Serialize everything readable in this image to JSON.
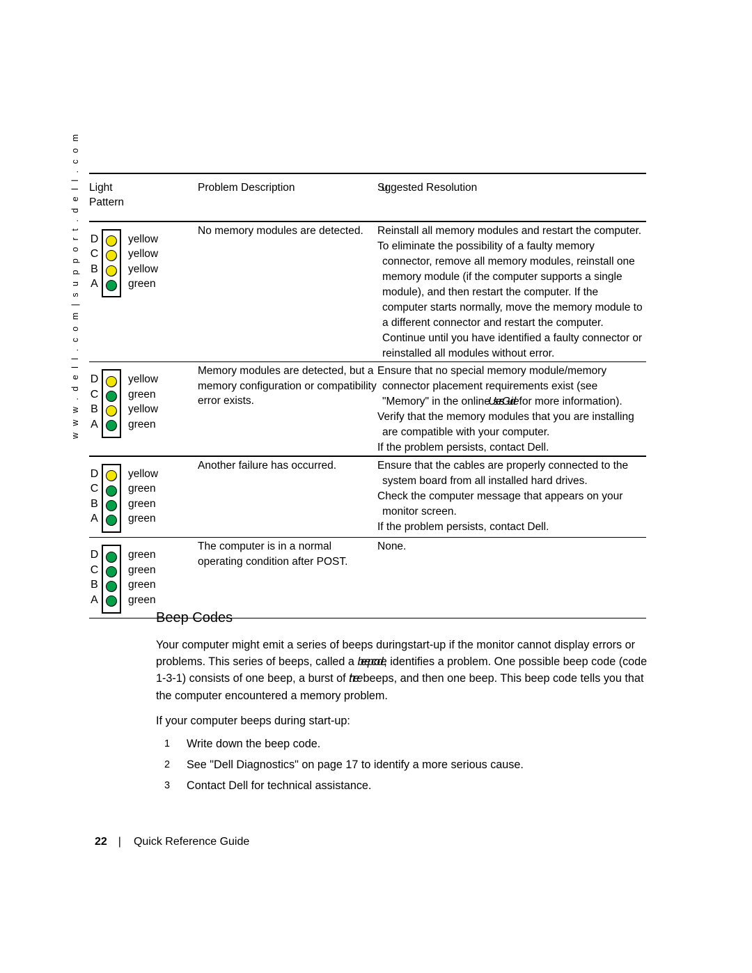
{
  "sidebar": {
    "running_head": "w w w . d e l l . c o m  |  s u p p o r t . d e l l . c o m"
  },
  "table": {
    "headers": {
      "pattern_line1": "Light",
      "pattern_line2": "Pattern",
      "problem": "Problem Description",
      "resolution_squeeze": "Su",
      "resolution_rest": "ggested Resolution"
    },
    "rows": [
      {
        "leds": [
          {
            "letter": "D",
            "color_name": "yellow",
            "color": "#F2E600"
          },
          {
            "letter": "C",
            "color_name": "yellow",
            "color": "#F2E600"
          },
          {
            "letter": "B",
            "color_name": "yellow",
            "color": "#F2E600"
          },
          {
            "letter": "A",
            "color_name": "green",
            "color": "#00A04A"
          }
        ],
        "problem": "No memory modules are detected.",
        "resolutions": [
          "Reinstall all memory modules and restart the computer.",
          "To eliminate the possibility of a faulty memory connector, remove all memory modules, reinstall one memory module (if the computer supports a single module), and then restart the computer. If the computer starts normally, move the memory module to a different connector and restart the computer. Continue until you have identified a faulty connector or reinstalled all modules without error."
        ]
      },
      {
        "leds": [
          {
            "letter": "D",
            "color_name": "yellow",
            "color": "#F2E600"
          },
          {
            "letter": "C",
            "color_name": "green",
            "color": "#00A04A"
          },
          {
            "letter": "B",
            "color_name": "yellow",
            "color": "#F2E600"
          },
          {
            "letter": "A",
            "color_name": "green",
            "color": "#00A04A"
          }
        ],
        "problem": "Memory modules are detected, but a memory configuration or compatibility error exists.",
        "resolutions": [
          "Ensure that no special memory module/memory connector placement requirements exist (see \"Memory\" in the online User s Guide for more information).",
          "Verify that the memory modules that you are installing are compatible with your computer.",
          "If the problem persists, contact Dell."
        ],
        "italic_phrase": "User s Guide"
      },
      {
        "leds": [
          {
            "letter": "D",
            "color_name": "yellow",
            "color": "#F2E600"
          },
          {
            "letter": "C",
            "color_name": "green",
            "color": "#00A04A"
          },
          {
            "letter": "B",
            "color_name": "green",
            "color": "#00A04A"
          },
          {
            "letter": "A",
            "color_name": "green",
            "color": "#00A04A"
          }
        ],
        "problem": "Another failure has occurred.",
        "resolutions": [
          "Ensure that the cables are properly connected to the system board from all installed hard drives.",
          "Check the computer message that appears on your monitor screen.",
          "If the problem persists, contact Dell."
        ]
      },
      {
        "leds": [
          {
            "letter": "D",
            "color_name": "green",
            "color": "#00A04A"
          },
          {
            "letter": "C",
            "color_name": "green",
            "color": "#00A04A"
          },
          {
            "letter": "B",
            "color_name": "green",
            "color": "#00A04A"
          },
          {
            "letter": "A",
            "color_name": "green",
            "color": "#00A04A"
          }
        ],
        "problem": "The computer is in a normal operating condition after POST.",
        "resolutions": [
          "None."
        ]
      }
    ]
  },
  "beep_codes": {
    "title": "Beep Codes",
    "para1_a": "Your computer might emit a series of beeps durin",
    "para1_b": "g",
    "para1_c": " start-up if the monitor cannot display errors or problems. This series of beeps, called a ",
    "para1_d": "beep code",
    "para1_e": ", identifies a problem. One possible beep code (code 1-3-1) consists of one beep, a burst of ",
    "para1_f": "three",
    "para1_g": " beeps, and then one beep. This beep code tells you that the computer encountered a memory problem.",
    "lead": "If your computer beeps during start-up:",
    "steps": [
      {
        "num": "1",
        "text": "Write down the beep code."
      },
      {
        "num": "2",
        "text": "See \"Dell Diagnostics\" on page 17 to identify a more serious cause."
      },
      {
        "num": "3",
        "text": "Contact Dell for technical assistance."
      }
    ]
  },
  "footer": {
    "page_number": "22",
    "separator": "|",
    "doc_title": "Quick Reference Guide"
  }
}
